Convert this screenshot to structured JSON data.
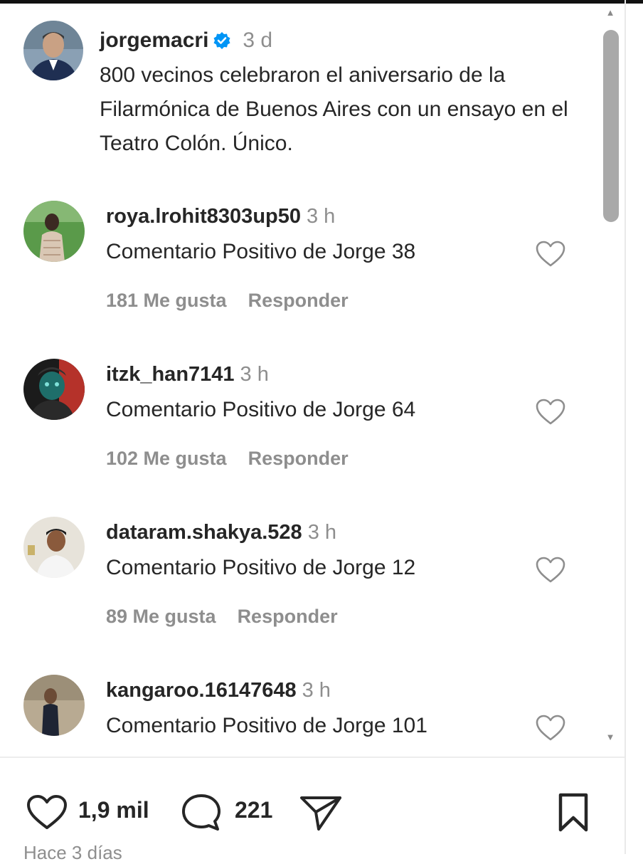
{
  "post": {
    "username": "jorgemacri",
    "verified": true,
    "time": "3 d",
    "caption": "800 vecinos celebraron el aniversario de la Filarmónica de Buenos Aires con un ensayo en el Teatro Colón. Único."
  },
  "comments": [
    {
      "username": "roya.lrohit8303up50",
      "time": "3 h",
      "text": "Comentario Positivo de Jorge 38",
      "likes": "181 Me gusta",
      "reply": "Responder"
    },
    {
      "username": "itzk_han7141",
      "time": "3 h",
      "text": "Comentario Positivo de Jorge 64",
      "likes": "102 Me gusta",
      "reply": "Responder"
    },
    {
      "username": "dataram.shakya.528",
      "time": "3 h",
      "text": "Comentario Positivo de Jorge 12",
      "likes": "89 Me gusta",
      "reply": "Responder"
    },
    {
      "username": "kangaroo.16147648",
      "time": "3 h",
      "text": "Comentario Positivo de Jorge 101"
    }
  ],
  "actions": {
    "likes_count": "1,9 mil",
    "comments_count": "221",
    "timestamp_partial": "Hace 3 días"
  },
  "icons": {
    "verified": "verified-badge-icon",
    "like": "heart-outline-icon",
    "comment": "speech-bubble-icon",
    "share": "paper-plane-icon",
    "save": "bookmark-icon"
  },
  "colors": {
    "verified_blue": "#0095f6",
    "muted_text": "#8e8e8e",
    "primary_text": "#262626"
  }
}
